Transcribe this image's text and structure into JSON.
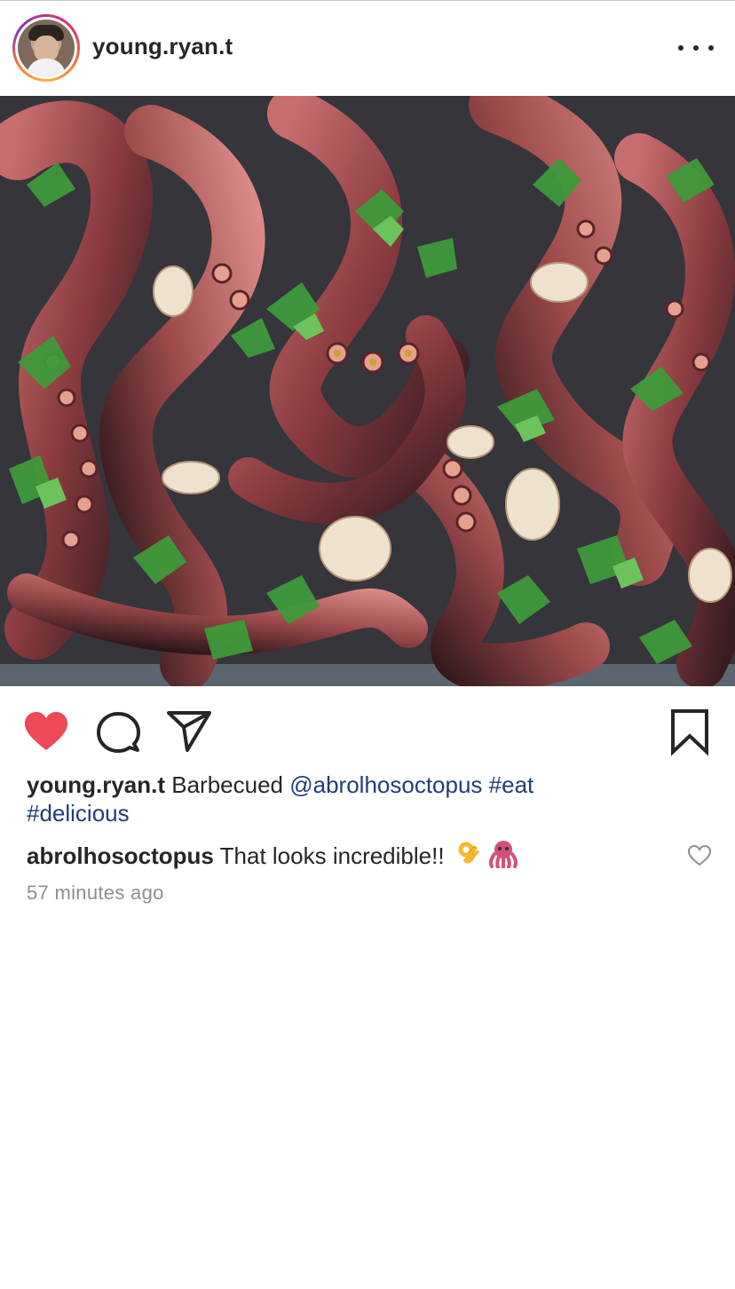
{
  "post": {
    "username": "young.ryan.t",
    "caption_user": "young.ryan.t",
    "caption_text": " Barbecued ",
    "caption_mention": "@abrolhosoctopus",
    "caption_space": " ",
    "caption_tag_1": "#eat",
    "caption_tag_2": "#delicious",
    "comment_user": "abrolhosoctopus",
    "comment_text": " That looks incredible!! ",
    "timestamp": "57 minutes ago",
    "liked": true
  },
  "icons": {
    "avatar": "profile-photo",
    "menu": "more-horizontal-icon",
    "like": "heart-filled-icon",
    "comment": "comment-bubble-icon",
    "share": "paper-plane-icon",
    "save": "bookmark-icon",
    "comment_like": "heart-outline-icon",
    "emoji_1": "ok-hand-emoji",
    "emoji_2": "octopus-emoji"
  },
  "colors": {
    "heart": "#ed4956",
    "link": "#1f3f74",
    "muted": "#8e8e8e",
    "text": "#262626"
  }
}
